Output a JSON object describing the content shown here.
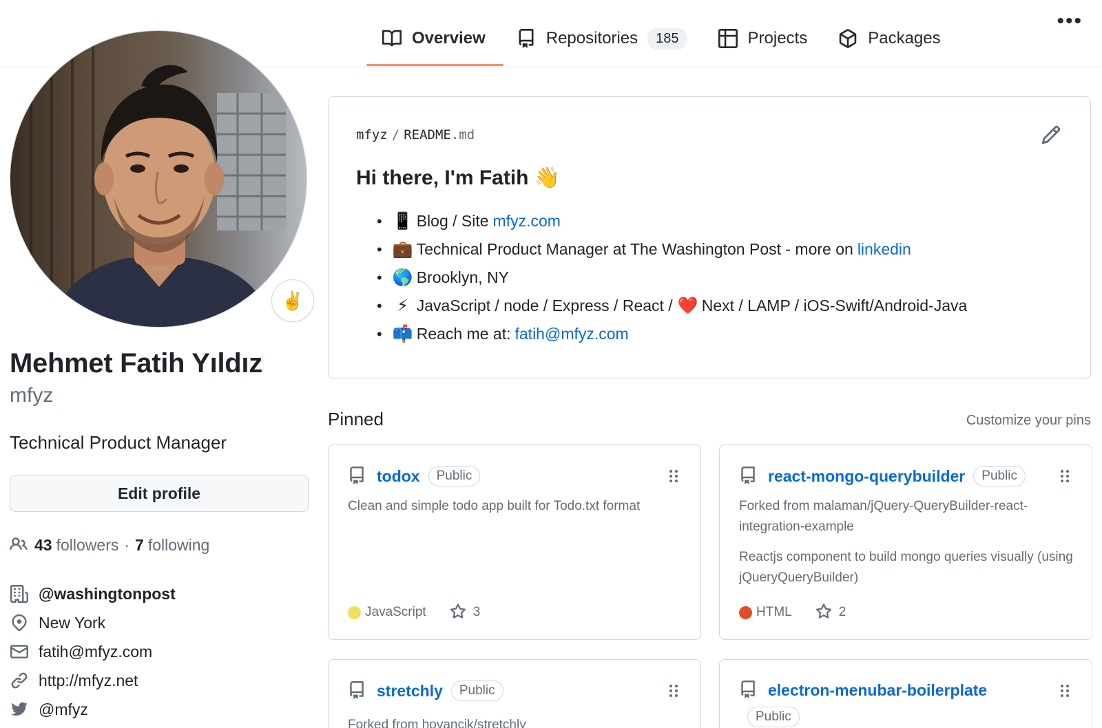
{
  "nav": {
    "tabs": [
      {
        "label": "Overview",
        "icon": "book-icon",
        "active": true
      },
      {
        "label": "Repositories",
        "icon": "repo-icon",
        "count": "185"
      },
      {
        "label": "Projects",
        "icon": "table-icon"
      },
      {
        "label": "Packages",
        "icon": "package-icon"
      }
    ],
    "more": "•••"
  },
  "profile": {
    "status_emoji": "✌️",
    "full_name": "Mehmet Fatih Yıldız",
    "username": "mfyz",
    "bio": "Technical Product Manager",
    "edit_label": "Edit profile",
    "followers_count": "43",
    "followers_label": "followers",
    "separator": "·",
    "following_count": "7",
    "following_label": "following",
    "details": {
      "organization": "@washingtonpost",
      "location": "New York",
      "email": "fatih@mfyz.com",
      "website": "http://mfyz.net",
      "twitter": "@mfyz"
    }
  },
  "readme": {
    "owner": "mfyz",
    "separator": "/",
    "file_name": "README",
    "file_ext": ".md",
    "title": "Hi there, I'm Fatih 👋",
    "items": [
      {
        "emoji": "📱",
        "text": "Blog / Site",
        "link": "mfyz.com"
      },
      {
        "emoji": "💼",
        "text": "Technical Product Manager at The Washington Post - more on",
        "link": "linkedin"
      },
      {
        "emoji": "🌎",
        "text": "Brooklyn, NY",
        "link": ""
      },
      {
        "emoji": "⚡",
        "text": "JavaScript / node / Express / React /",
        "heart": "❤️",
        "text2": "Next / LAMP / iOS-Swift/Android-Java"
      },
      {
        "emoji": "📫",
        "text": "Reach me at:",
        "link": "fatih@mfyz.com"
      }
    ]
  },
  "pinned": {
    "title": "Pinned",
    "customize": "Customize your pins",
    "cards": [
      {
        "name": "todox",
        "visibility": "Public",
        "description": "Clean and simple todo app built for Todo.txt format",
        "language": "JavaScript",
        "language_color": "#f1e05a",
        "stars": "3"
      },
      {
        "name": "react-mongo-querybuilder",
        "visibility": "Public",
        "forked_from": "Forked from malaman/jQuery-QueryBuilder-react-integration-example",
        "description": "Reactjs component to build mongo queries visually (using jQueryQueryBuilder)",
        "language": "HTML",
        "language_color": "#e34c26",
        "stars": "2"
      },
      {
        "name": "stretchly",
        "visibility": "Public",
        "forked_from": "Forked from hovancik/stretchly"
      },
      {
        "name": "electron-menubar-boilerplate",
        "visibility": "Public"
      }
    ]
  },
  "colors": {
    "accent": "#0969da",
    "tab_underline": "#fd8c73",
    "border": "#d0d7de",
    "muted": "#636c76"
  }
}
